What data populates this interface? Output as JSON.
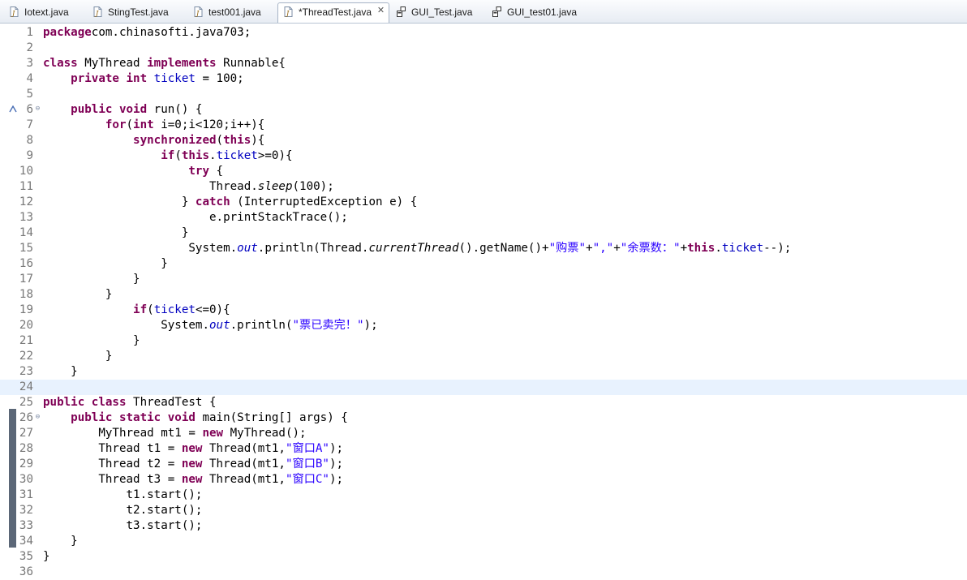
{
  "tabs": [
    {
      "label": "Iotext.java",
      "icon": "java-file-icon",
      "active": false
    },
    {
      "label": "StingTest.java",
      "icon": "java-file-icon",
      "active": false
    },
    {
      "label": "test001.java",
      "icon": "java-file-icon",
      "active": false
    },
    {
      "label": "*ThreadTest.java",
      "icon": "java-file-icon",
      "active": true,
      "close": "✕"
    },
    {
      "label": "GUI_Test.java",
      "icon": "gui-class-icon",
      "active": false
    },
    {
      "label": "GUI_test01.java",
      "icon": "gui-class-icon",
      "active": false
    }
  ],
  "colors": {
    "keyword": "#7f0055",
    "field": "#0000c0",
    "string": "#2a00ff",
    "line_number": "#787878",
    "current_line": "#e8f2fe",
    "change_bar": "#5b6777"
  },
  "current_line": 24,
  "lines": [
    {
      "n": "1",
      "parts": [
        [
          "kw",
          "package"
        ],
        [
          "",
          "com.chinasofti.java703;"
        ]
      ]
    },
    {
      "n": "2",
      "parts": []
    },
    {
      "n": "3",
      "parts": [
        [
          "kw",
          "class"
        ],
        [
          "",
          " MyThread "
        ],
        [
          "kw",
          "implements"
        ],
        [
          "",
          " Runnable{"
        ]
      ]
    },
    {
      "n": "4",
      "parts": [
        [
          "",
          "    "
        ],
        [
          "kw",
          "private"
        ],
        [
          "",
          ""
        ],
        [
          "kw",
          " int"
        ],
        [
          "fld",
          " ticket"
        ],
        [
          "",
          " = 100;"
        ]
      ]
    },
    {
      "n": "5",
      "parts": []
    },
    {
      "n": "6",
      "parts": [
        [
          "",
          "    "
        ],
        [
          "kw",
          "public"
        ],
        [
          "kw",
          " void"
        ],
        [
          "",
          " run() {"
        ]
      ],
      "fold": "⊖",
      "override": true
    },
    {
      "n": "7",
      "parts": [
        [
          "",
          "         "
        ],
        [
          "kw",
          "for"
        ],
        [
          "",
          "("
        ],
        [
          "kw",
          "int"
        ],
        [
          "",
          " i=0;i<120;i++){"
        ]
      ]
    },
    {
      "n": "8",
      "parts": [
        [
          "",
          "             "
        ],
        [
          "kw",
          "synchronized"
        ],
        [
          "",
          "("
        ],
        [
          "kw",
          "this"
        ],
        [
          "",
          "){"
        ]
      ]
    },
    {
      "n": "9",
      "parts": [
        [
          "",
          "                 "
        ],
        [
          "kw",
          "if"
        ],
        [
          "",
          "("
        ],
        [
          "kw",
          "this"
        ],
        [
          "",
          "."
        ],
        [
          "fld",
          "ticket"
        ],
        [
          "",
          ">=0){"
        ]
      ]
    },
    {
      "n": "10",
      "parts": [
        [
          "",
          "                     "
        ],
        [
          "kw",
          "try"
        ],
        [
          "",
          " {"
        ]
      ]
    },
    {
      "n": "11",
      "parts": [
        [
          "",
          "                        Thread."
        ],
        [
          "ital",
          "sleep"
        ],
        [
          "",
          "(100);"
        ]
      ]
    },
    {
      "n": "12",
      "parts": [
        [
          "",
          "                    } "
        ],
        [
          "kw",
          "catch"
        ],
        [
          "",
          " (InterruptedException e) {"
        ]
      ]
    },
    {
      "n": "13",
      "parts": [
        [
          "",
          "                        e.printStackTrace();"
        ]
      ]
    },
    {
      "n": "14",
      "parts": [
        [
          "",
          "                    }"
        ]
      ]
    },
    {
      "n": "15",
      "parts": [
        [
          "",
          "                     System."
        ],
        [
          "italfld",
          "out"
        ],
        [
          "",
          ".println(Thread."
        ],
        [
          "ital",
          "currentThread"
        ],
        [
          "",
          "().getName()+"
        ],
        [
          "str",
          "\"购票\""
        ],
        [
          "",
          "+"
        ],
        [
          "str",
          "\",\""
        ],
        [
          "",
          "+"
        ],
        [
          "str",
          "\"余票数：\""
        ],
        [
          "",
          "+"
        ],
        [
          "kw",
          "this"
        ],
        [
          "",
          "."
        ],
        [
          "fld",
          "ticket"
        ],
        [
          "",
          "--);"
        ]
      ]
    },
    {
      "n": "16",
      "parts": [
        [
          "",
          "                 }"
        ]
      ]
    },
    {
      "n": "17",
      "parts": [
        [
          "",
          "             }"
        ]
      ]
    },
    {
      "n": "18",
      "parts": [
        [
          "",
          "         }"
        ]
      ]
    },
    {
      "n": "19",
      "parts": [
        [
          "",
          "             "
        ],
        [
          "kw",
          "if"
        ],
        [
          "",
          "("
        ],
        [
          "fld",
          "ticket"
        ],
        [
          "",
          "<=0){"
        ]
      ]
    },
    {
      "n": "20",
      "parts": [
        [
          "",
          "                 System."
        ],
        [
          "italfld",
          "out"
        ],
        [
          "",
          ".println("
        ],
        [
          "str",
          "\"票已卖完！\""
        ],
        [
          "",
          ");"
        ]
      ]
    },
    {
      "n": "21",
      "parts": [
        [
          "",
          "             }"
        ]
      ]
    },
    {
      "n": "22",
      "parts": [
        [
          "",
          "         }"
        ]
      ]
    },
    {
      "n": "23",
      "parts": [
        [
          "",
          "    }"
        ]
      ]
    },
    {
      "n": "24",
      "parts": []
    },
    {
      "n": "25",
      "parts": [
        [
          "kw",
          "public"
        ],
        [
          "kw",
          " class"
        ],
        [
          "",
          " ThreadTest {"
        ]
      ]
    },
    {
      "n": "26",
      "parts": [
        [
          "",
          "    "
        ],
        [
          "kw",
          "public"
        ],
        [
          "kw",
          " static"
        ],
        [
          "kw",
          " void"
        ],
        [
          "",
          " main(String[] args) {"
        ]
      ],
      "fold": "⊖"
    },
    {
      "n": "27",
      "parts": [
        [
          "",
          "        MyThread mt1 = "
        ],
        [
          "kw",
          "new"
        ],
        [
          "",
          " MyThread();"
        ]
      ]
    },
    {
      "n": "28",
      "parts": [
        [
          "",
          "        Thread t1 = "
        ],
        [
          "kw",
          "new"
        ],
        [
          "",
          " Thread(mt1,"
        ],
        [
          "str",
          "\"窗口A\""
        ],
        [
          "",
          ");"
        ]
      ]
    },
    {
      "n": "29",
      "parts": [
        [
          "",
          "        Thread t2 = "
        ],
        [
          "kw",
          "new"
        ],
        [
          "",
          " Thread(mt1,"
        ],
        [
          "str",
          "\"窗口B\""
        ],
        [
          "",
          ");"
        ]
      ]
    },
    {
      "n": "30",
      "parts": [
        [
          "",
          "        Thread t3 = "
        ],
        [
          "kw",
          "new"
        ],
        [
          "",
          " Thread(mt1,"
        ],
        [
          "str",
          "\"窗口C\""
        ],
        [
          "",
          ");"
        ]
      ]
    },
    {
      "n": "31",
      "parts": [
        [
          "",
          "            t1.start();"
        ]
      ]
    },
    {
      "n": "32",
      "parts": [
        [
          "",
          "            t2.start();"
        ]
      ]
    },
    {
      "n": "33",
      "parts": [
        [
          "",
          "            t3.start();"
        ]
      ]
    },
    {
      "n": "34",
      "parts": [
        [
          "",
          "    }"
        ]
      ]
    },
    {
      "n": "35",
      "parts": [
        [
          "",
          "}"
        ]
      ]
    },
    {
      "n": "36",
      "parts": []
    }
  ]
}
